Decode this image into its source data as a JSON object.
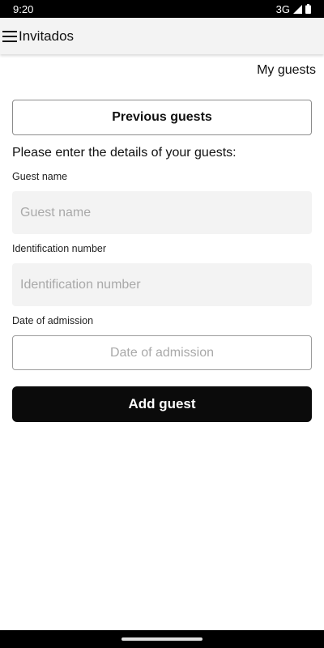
{
  "status_bar": {
    "time": "9:20",
    "network": "3G"
  },
  "app_bar": {
    "title": "Invitados"
  },
  "header_link": {
    "label": "My guests"
  },
  "previous_guests_button": {
    "label": "Previous guests"
  },
  "form": {
    "instructions": "Please enter the details of your guests:",
    "guest_name": {
      "label": "Guest name",
      "value": "",
      "placeholder": "Guest name"
    },
    "identification_number": {
      "label": "Identification number",
      "value": "",
      "placeholder": "Identification number"
    },
    "date_of_admission": {
      "label": "Date of admission",
      "value": "",
      "placeholder": "Date of admission"
    },
    "submit_label": "Add guest"
  },
  "colors": {
    "primary_button": "#0b0b0b",
    "input_fill": "#f3f3f3",
    "app_bar": "#f3f3f3",
    "placeholder": "#a9a9a9"
  },
  "icons": {
    "menu": "hamburger-menu-icon",
    "signal": "signal-icon",
    "battery": "battery-icon"
  }
}
